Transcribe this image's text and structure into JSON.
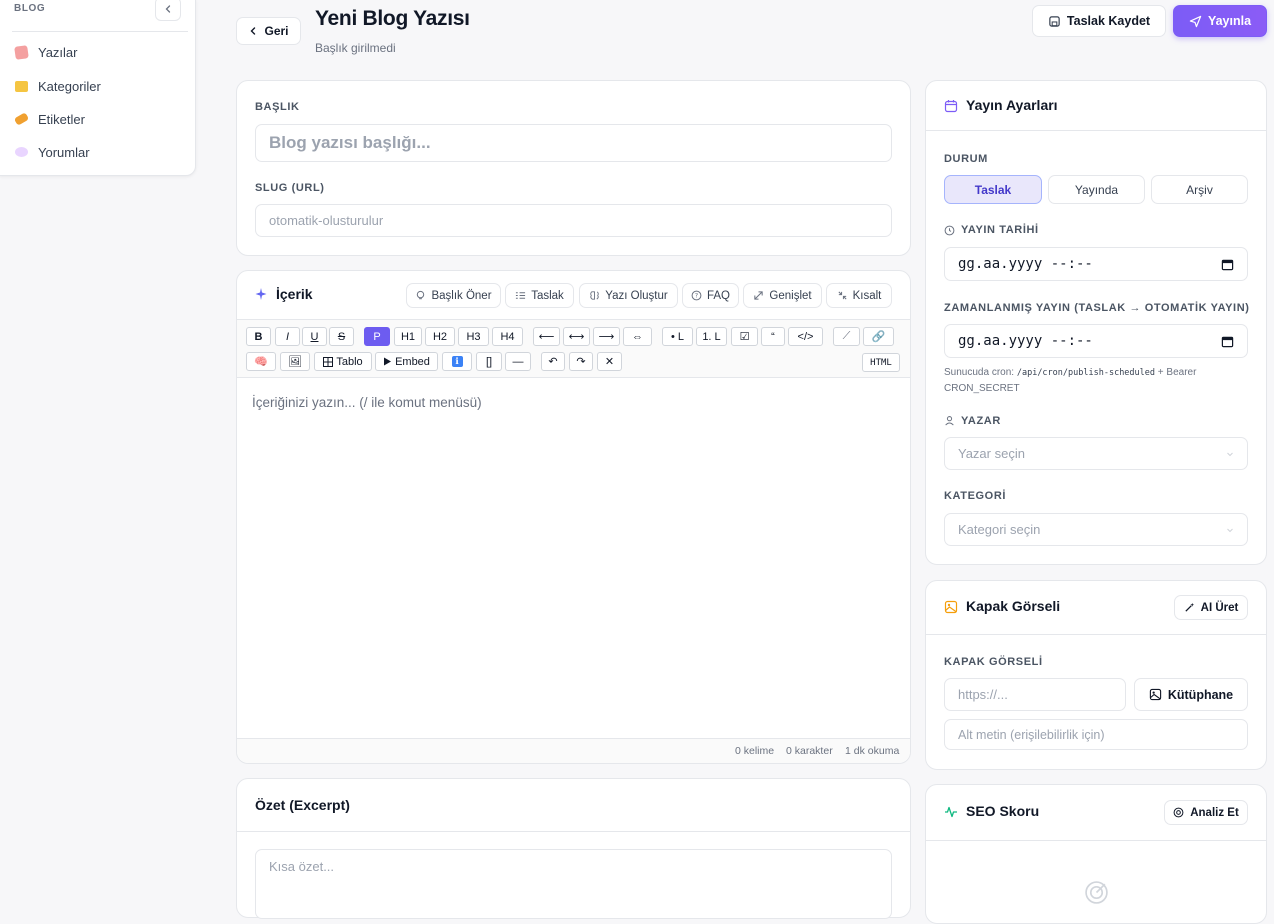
{
  "sidebar": {
    "section_label": "BLOG",
    "collapse_icon": "chevron-left-icon",
    "items": [
      {
        "label": "Yazılar",
        "icon": "memo-icon",
        "color": "#f4a0a0"
      },
      {
        "label": "Kategoriler",
        "icon": "folder-icon",
        "color": "#f5c542"
      },
      {
        "label": "Etiketler",
        "icon": "tag-icon",
        "color": "#f0a030"
      },
      {
        "label": "Yorumlar",
        "icon": "speech-bubble-icon",
        "color": "#d8b4fe"
      }
    ]
  },
  "header": {
    "back_label": "Geri",
    "title": "Yeni Blog Yazısı",
    "subtitle": "Başlık girilmedi",
    "save_draft_label": "Taslak Kaydet",
    "publish_label": "Yayınla",
    "accent": "#7c5cf6"
  },
  "title_section": {
    "title_label": "BAŞLIK",
    "title_placeholder": "Blog yazısı başlığı...",
    "slug_label": "SLUG (URL)",
    "slug_placeholder": "otomatik-olusturulur"
  },
  "content": {
    "heading": "İçerik",
    "ai_buttons": [
      "Başlık Öner",
      "Taslak",
      "Yazı Oluştur",
      "FAQ",
      "Genişlet",
      "Kısalt"
    ],
    "toolbar_row1": [
      "B",
      "I",
      "U",
      "S",
      "P",
      "H1",
      "H2",
      "H3",
      "H4",
      "⟵",
      "⟷",
      "⟶",
      "⇔",
      "• L",
      "1. L",
      "☑",
      "“",
      "</>",
      "⟋",
      "🔗"
    ],
    "toolbar_row2": [
      "🧠",
      "🖼",
      "Tablo",
      "Embed",
      "ℹ",
      "[]",
      "—",
      "↶",
      "↷",
      "✕",
      "HTML"
    ],
    "editor_placeholder": "İçeriğinizi yazın... (/ ile komut menüsü)",
    "word_count": "0 kelime",
    "char_count": "0 karakter",
    "read_time": "1 dk okuma"
  },
  "excerpt": {
    "heading": "Özet (Excerpt)",
    "placeholder": "Kısa özet..."
  },
  "publish_settings": {
    "heading": "Yayın Ayarları",
    "status_label": "DURUM",
    "status_options": [
      "Taslak",
      "Yayında",
      "Arşiv"
    ],
    "status_selected": "Taslak",
    "publish_date_label": "YAYIN TARİHİ",
    "publish_date_value": "gg.aa.yyyy --:--",
    "scheduled_label": "ZAMANLANMIŞ YAYIN (TASLAK → OTOMATİK YAYIN)",
    "scheduled_value": "gg.aa.yyyy --:--",
    "cron_prefix": "Sunucuda cron:",
    "cron_path": "/api/cron/publish-scheduled",
    "cron_suffix": "+ Bearer",
    "cron_secret": "CRON_SECRET",
    "author_label": "YAZAR",
    "author_placeholder": "Yazar seçin",
    "category_label": "KATEGORİ",
    "category_placeholder": "Kategori seçin"
  },
  "cover": {
    "heading": "Kapak Görseli",
    "ai_label": "AI Üret",
    "field_label": "KAPAK GÖRSELİ",
    "url_placeholder": "https://...",
    "library_label": "Kütüphane",
    "alt_placeholder": "Alt metin (erişilebilirlik için)"
  },
  "seo": {
    "heading": "SEO Skoru",
    "analyze_label": "Analiz Et"
  }
}
